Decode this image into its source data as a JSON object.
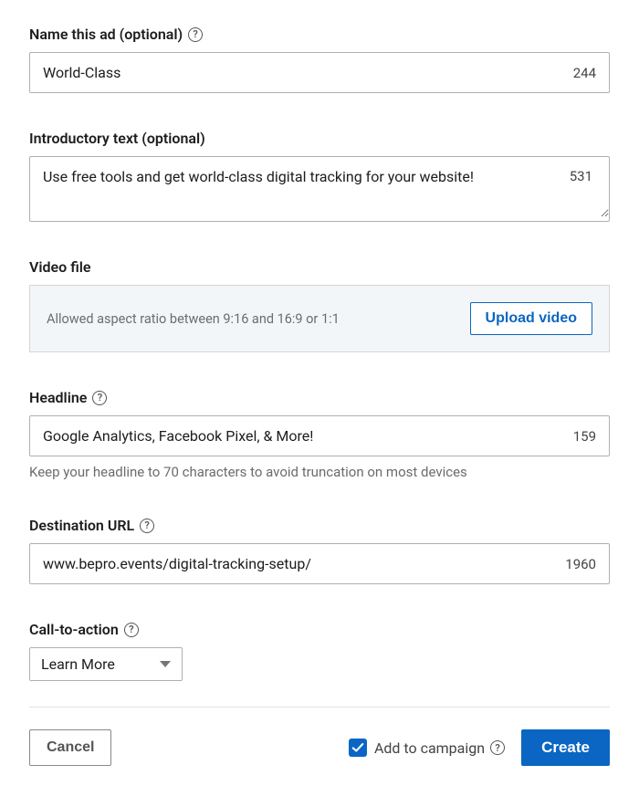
{
  "ad_name": {
    "label": "Name this ad (optional)",
    "value": "World-Class",
    "remaining": "244"
  },
  "intro_text": {
    "label": "Introductory text (optional)",
    "value": "Use free tools and get world-class digital tracking for your website!",
    "remaining": "531"
  },
  "video": {
    "label": "Video file",
    "hint": "Allowed aspect ratio between 9:16 and 16:9 or 1:1",
    "upload_label": "Upload video"
  },
  "headline": {
    "label": "Headline",
    "value": "Google Analytics, Facebook Pixel, & More!",
    "remaining": "159",
    "hint": "Keep your headline to 70 characters to avoid truncation on most devices"
  },
  "destination": {
    "label": "Destination URL",
    "value": "www.bepro.events/digital-tracking-setup/",
    "remaining": "1960"
  },
  "cta": {
    "label": "Call-to-action",
    "selected": "Learn More"
  },
  "footer": {
    "cancel": "Cancel",
    "add_to_campaign": "Add to campaign",
    "create": "Create"
  }
}
